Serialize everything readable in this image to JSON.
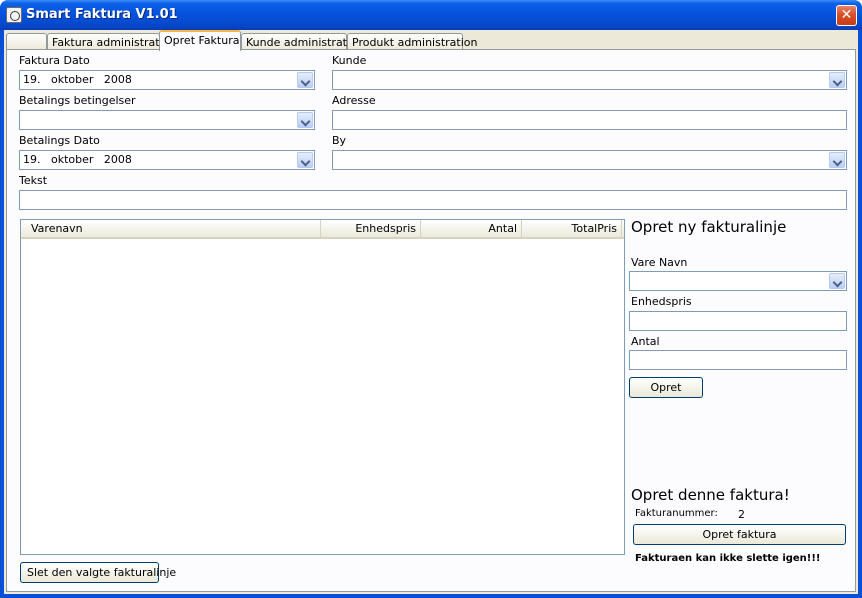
{
  "window": {
    "title": "Smart Faktura V1.01",
    "close_glyph": "✕"
  },
  "tabs": [
    {
      "label": ""
    },
    {
      "label": "Faktura administration"
    },
    {
      "label": "Opret Faktura"
    },
    {
      "label": "Kunde administration"
    },
    {
      "label": "Produkt administration"
    }
  ],
  "invoice_form": {
    "faktura_dato_label": "Faktura Dato",
    "faktura_dato_value": "19.   oktober   2008",
    "betalings_betingelser_label": "Betalings betingelser",
    "betalings_betingelser_value": "",
    "betalings_dato_label": "Betalings Dato",
    "betalings_dato_value": "19.   oktober   2008",
    "kunde_label": "Kunde",
    "kunde_value": "",
    "adresse_label": "Adresse",
    "adresse_value": "",
    "by_label": "By",
    "by_value": "",
    "tekst_label": "Tekst",
    "tekst_value": ""
  },
  "lines_table": {
    "columns": [
      "Varenavn",
      "Enhedspris",
      "Antal",
      "TotalPris"
    ],
    "rows": []
  },
  "new_line_panel": {
    "heading": "Opret ny fakturalinje",
    "vare_navn_label": "Vare Navn",
    "vare_navn_value": "",
    "enhedspris_label": "Enhedspris",
    "enhedspris_value": "",
    "antal_label": "Antal",
    "antal_value": "",
    "opret_button": "Opret"
  },
  "create_invoice_panel": {
    "heading": "Opret denne faktura!",
    "fakturanummer_label": "Fakturanummer:",
    "fakturanummer_value": "2",
    "opret_faktura_button": "Opret faktura",
    "warning": "Fakturaen kan ikke slette igen!!!"
  },
  "delete_line_button": "Slet den valgte fakturalinje"
}
